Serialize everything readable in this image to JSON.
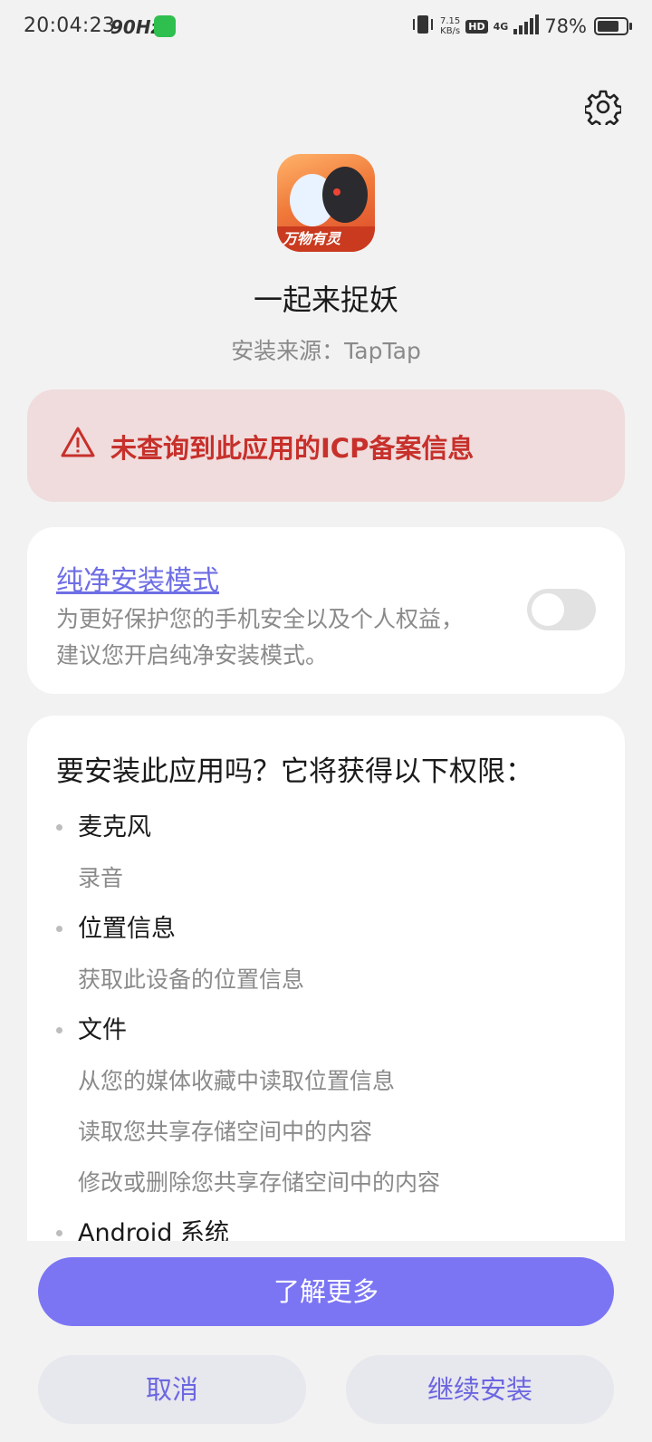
{
  "status_bar": {
    "time": "20:04:23",
    "refresh_rate": "90Hz",
    "net_speed_value": "7.15",
    "net_speed_unit": "KB/s",
    "hd_label": "HD",
    "network_type": "4G",
    "battery_percent": "78%",
    "battery_level": 0.78
  },
  "app": {
    "name": "一起来捉妖",
    "source": "安装来源：TapTap",
    "icon_text": "万物有灵"
  },
  "warning": {
    "text": "未查询到此应用的ICP备案信息",
    "color": "#c7302b"
  },
  "pure_mode": {
    "title": "纯净安装模式",
    "description": "为更好保护您的手机安全以及个人权益，建议您开启纯净安装模式。",
    "enabled": false
  },
  "permissions": {
    "title": "要安装此应用吗？它将获得以下权限：",
    "items": [
      {
        "name": "麦克风",
        "details": [
          "录音"
        ]
      },
      {
        "name": "位置信息",
        "details": [
          "获取此设备的位置信息"
        ]
      },
      {
        "name": "文件",
        "details": [
          "从您的媒体收藏中读取位置信息",
          "读取您共享存储空间中的内容",
          "修改或删除您共享存储空间中的内容"
        ]
      },
      {
        "name": "Android 系统",
        "details": []
      }
    ]
  },
  "buttons": {
    "learn_more": "了解更多",
    "cancel": "取消",
    "continue": "继续安装"
  },
  "colors": {
    "accent": "#7b75f4",
    "secondary_button_bg": "#e7e7ee",
    "warning_bg": "#f0dcdc"
  }
}
